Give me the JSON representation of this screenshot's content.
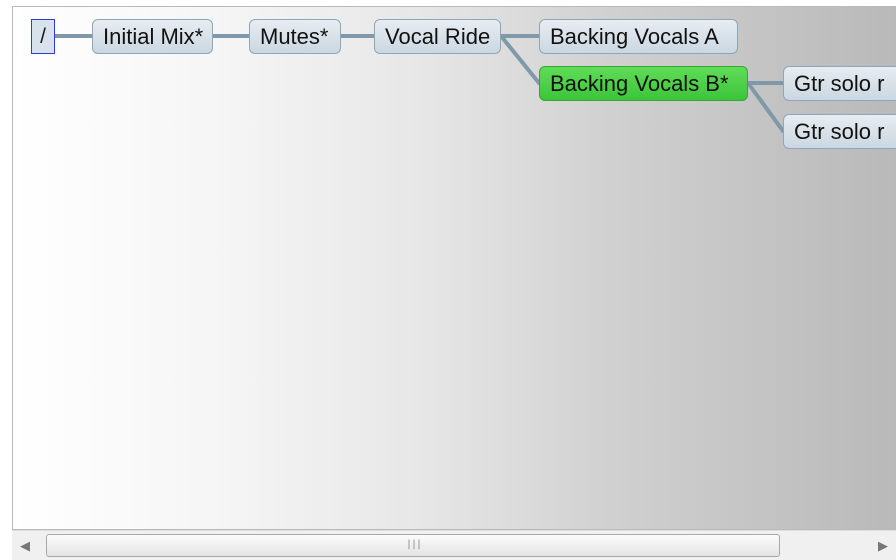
{
  "tree": {
    "root": {
      "label": "/"
    },
    "nodes": [
      {
        "label": "Initial Mix*",
        "state": "normal"
      },
      {
        "label": "Mutes*",
        "state": "normal"
      },
      {
        "label": "Vocal Ride",
        "state": "normal"
      },
      {
        "label": "Backing Vocals A",
        "state": "normal"
      },
      {
        "label": "Backing Vocals B*",
        "state": "selected"
      },
      {
        "label": "Gtr solo r",
        "state": "normal"
      },
      {
        "label": "Gtr solo r",
        "state": "normal"
      }
    ],
    "colors": {
      "node_fill": "#cbd7e1",
      "node_border": "#8da6b9",
      "connector": "#7f99a8",
      "selected_fill": "#3cc53a",
      "root_border": "#2f3ed0"
    }
  },
  "scrollbar": {
    "left_icon": "left-arrow-icon",
    "right_icon": "right-arrow-icon",
    "grip_icon": "scroll-grip-icon",
    "left_glyph": "◀",
    "right_glyph": "▶",
    "grip_glyph": "|||"
  }
}
